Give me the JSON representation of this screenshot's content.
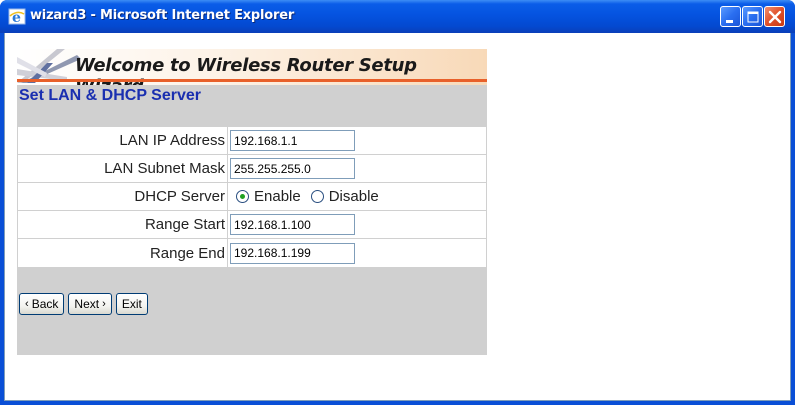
{
  "window": {
    "title": "wizard3 - Microsoft Internet Explorer"
  },
  "banner": {
    "title": "Welcome to Wireless Router Setup Wizard"
  },
  "section": {
    "title": "Set LAN & DHCP Server"
  },
  "form": {
    "lan_ip_label": "LAN IP Address",
    "lan_ip_value": "192.168.1.1",
    "subnet_label": "LAN Subnet Mask",
    "subnet_value": "255.255.255.0",
    "dhcp_label": "DHCP Server",
    "dhcp_enable_label": "Enable",
    "dhcp_disable_label": "Disable",
    "dhcp_selected": "Enable",
    "range_start_label": "Range Start",
    "range_start_value": "192.168.1.100",
    "range_end_label": "Range End",
    "range_end_value": "192.168.1.199"
  },
  "buttons": {
    "back_label": "Back",
    "next_label": "Next",
    "exit_label": "Exit"
  },
  "colors": {
    "titlebar": "#0553e0",
    "section_title": "#1a2fb0",
    "banner_accent": "#e8602a",
    "panel_bg": "#d0d0d0"
  },
  "icons": [
    "ie-icon",
    "minimize-icon",
    "maximize-icon",
    "close-icon",
    "banner-rays-icon",
    "left-arrow-icon",
    "right-arrow-icon"
  ]
}
